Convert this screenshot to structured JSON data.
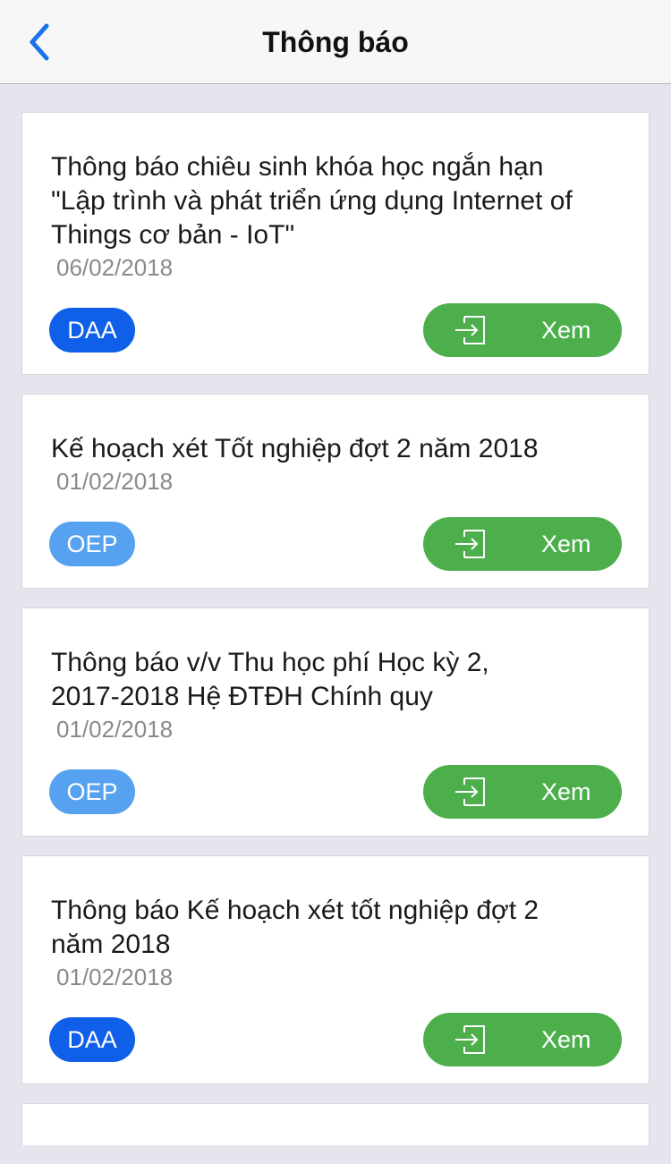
{
  "header": {
    "title": "Thông báo",
    "back_icon": "chevron-left-icon"
  },
  "colors": {
    "accent": "#1a73e8",
    "badge_dark": "#0f5fe8",
    "badge_light": "#56a2f0",
    "view_button": "#4daf4c",
    "background": "#e6e5ed"
  },
  "notifications": [
    {
      "title_lines": [
        "Thông báo chiêu sinh khóa học ngắn hạn",
        "\"Lập trình và phát triển ứng dụng Internet of",
        "Things cơ bản - IoT\""
      ],
      "date": "06/02/2018",
      "tag": "DAA",
      "view_label": "Xem",
      "view_icon": "sign-in-icon"
    },
    {
      "title_lines": [
        "Kế hoạch xét Tốt nghiệp đợt 2 năm 2018"
      ],
      "date": "01/02/2018",
      "tag": "OEP",
      "view_label": "Xem",
      "view_icon": "sign-in-icon"
    },
    {
      "title_lines": [
        "Thông báo v/v Thu học phí Học kỳ 2,",
        "2017-2018 Hệ ĐTĐH Chính quy"
      ],
      "date": "01/02/2018",
      "tag": "OEP",
      "view_label": "Xem",
      "view_icon": "sign-in-icon"
    },
    {
      "title_lines": [
        "Thông báo Kế hoạch xét tốt nghiệp đợt 2",
        "năm 2018"
      ],
      "date": "01/02/2018",
      "tag": "DAA",
      "view_label": "Xem",
      "view_icon": "sign-in-icon"
    }
  ]
}
